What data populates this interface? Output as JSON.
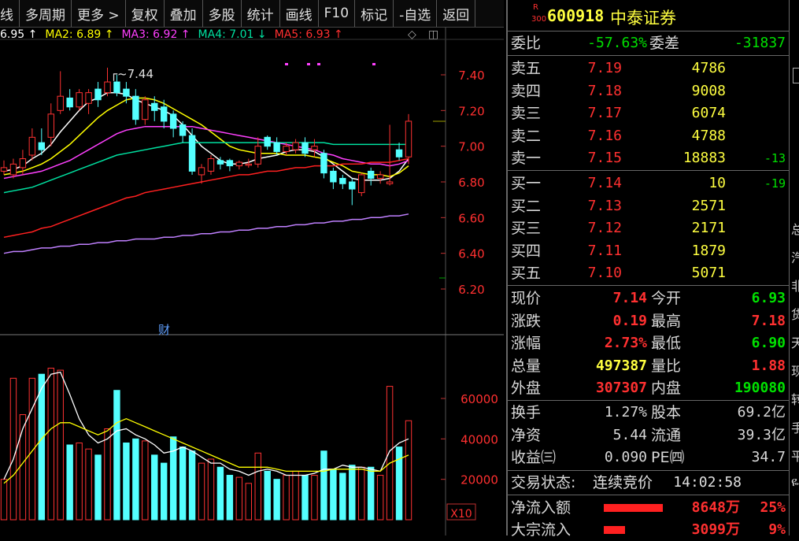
{
  "toolbar": {
    "items": [
      "线",
      "多周期",
      "更多 >",
      "复权",
      "叠加",
      "多股",
      "统计",
      "画线",
      "F10",
      "标记",
      "-自选",
      "返回"
    ]
  },
  "ma": [
    {
      "label": "6.95",
      "arrow": "↑",
      "color": "#ffffff"
    },
    {
      "label": "MA2: 6.89",
      "arrow": "↑",
      "color": "#ffff00"
    },
    {
      "label": "MA3: 6.92",
      "arrow": "↑",
      "color": "#ff40ff"
    },
    {
      "label": "MA4: 7.01",
      "arrow": "↓",
      "color": "#00e0a0"
    },
    {
      "label": "MA5: 6.93",
      "arrow": "↑",
      "color": "#ff3030"
    }
  ],
  "chart_data": {
    "type": "candlestick",
    "price_ticks": [
      "7.40",
      "7.20",
      "7.00",
      "6.80",
      "6.60",
      "6.40",
      "6.20"
    ],
    "price_range": [
      6.2,
      7.48
    ],
    "volume_ticks": [
      "60000",
      "40000",
      "20000"
    ],
    "volume_unit": "X10",
    "high_label": "7.44",
    "marker_label": "财",
    "candles": [
      {
        "o": 6.86,
        "c": 6.88,
        "h": 6.92,
        "l": 6.84,
        "v": 20000
      },
      {
        "o": 6.84,
        "c": 6.9,
        "h": 6.93,
        "l": 6.82,
        "v": 70000
      },
      {
        "o": 6.88,
        "c": 6.93,
        "h": 6.98,
        "l": 6.84,
        "v": 52000
      },
      {
        "o": 6.95,
        "c": 7.05,
        "h": 7.1,
        "l": 6.92,
        "v": 70000
      },
      {
        "o": 7.02,
        "c": 6.98,
        "h": 7.1,
        "l": 6.95,
        "v": 72000
      },
      {
        "o": 7.05,
        "c": 7.18,
        "h": 7.24,
        "l": 7.0,
        "v": 75000
      },
      {
        "o": 7.2,
        "c": 7.28,
        "h": 7.42,
        "l": 7.18,
        "v": 74000
      },
      {
        "o": 7.27,
        "c": 7.22,
        "h": 7.32,
        "l": 7.2,
        "v": 37000
      },
      {
        "o": 7.22,
        "c": 7.3,
        "h": 7.32,
        "l": 7.2,
        "v": 38000
      },
      {
        "o": 7.24,
        "c": 7.3,
        "h": 7.32,
        "l": 7.18,
        "v": 35000
      },
      {
        "o": 7.32,
        "c": 7.26,
        "h": 7.36,
        "l": 7.22,
        "v": 32000
      },
      {
        "o": 7.3,
        "c": 7.36,
        "h": 7.44,
        "l": 7.28,
        "v": 45000
      },
      {
        "o": 7.36,
        "c": 7.3,
        "h": 7.4,
        "l": 7.28,
        "v": 64000
      },
      {
        "o": 7.32,
        "c": 7.28,
        "h": 7.36,
        "l": 7.24,
        "v": 38000
      },
      {
        "o": 7.28,
        "c": 7.15,
        "h": 7.32,
        "l": 7.12,
        "v": 40000
      },
      {
        "o": 7.15,
        "c": 7.26,
        "h": 7.28,
        "l": 7.12,
        "v": 39000
      },
      {
        "o": 7.24,
        "c": 7.2,
        "h": 7.28,
        "l": 7.14,
        "v": 32000
      },
      {
        "o": 7.22,
        "c": 7.14,
        "h": 7.26,
        "l": 7.1,
        "v": 28000
      },
      {
        "o": 7.18,
        "c": 7.1,
        "h": 7.2,
        "l": 7.05,
        "v": 41000
      },
      {
        "o": 7.12,
        "c": 7.06,
        "h": 7.14,
        "l": 7.02,
        "v": 36000
      },
      {
        "o": 7.06,
        "c": 6.86,
        "h": 7.1,
        "l": 6.84,
        "v": 34000
      },
      {
        "o": 6.84,
        "c": 6.88,
        "h": 6.9,
        "l": 6.79,
        "v": 28000
      },
      {
        "o": 6.86,
        "c": 6.93,
        "h": 6.95,
        "l": 6.84,
        "v": 30000
      },
      {
        "o": 6.92,
        "c": 6.9,
        "h": 6.94,
        "l": 6.87,
        "v": 26000
      },
      {
        "o": 6.92,
        "c": 6.89,
        "h": 6.93,
        "l": 6.86,
        "v": 22000
      },
      {
        "o": 6.89,
        "c": 6.91,
        "h": 6.92,
        "l": 6.87,
        "v": 21000
      },
      {
        "o": 6.9,
        "c": 6.9,
        "h": 6.93,
        "l": 6.88,
        "v": 18000
      },
      {
        "o": 6.9,
        "c": 7.0,
        "h": 7.05,
        "l": 6.88,
        "v": 33000
      },
      {
        "o": 7.05,
        "c": 7.0,
        "h": 7.06,
        "l": 6.98,
        "v": 24000
      },
      {
        "o": 7.02,
        "c": 6.97,
        "h": 7.05,
        "l": 6.95,
        "v": 20000
      },
      {
        "o": 6.97,
        "c": 7.0,
        "h": 7.02,
        "l": 6.95,
        "v": 22000
      },
      {
        "o": 6.98,
        "c": 7.02,
        "h": 7.04,
        "l": 6.96,
        "v": 24000
      },
      {
        "o": 7.02,
        "c": 6.96,
        "h": 7.05,
        "l": 6.94,
        "v": 22000
      },
      {
        "o": 6.98,
        "c": 7.0,
        "h": 7.04,
        "l": 6.94,
        "v": 22000
      },
      {
        "o": 6.96,
        "c": 6.85,
        "h": 6.98,
        "l": 6.82,
        "v": 34000
      },
      {
        "o": 6.86,
        "c": 6.8,
        "h": 6.88,
        "l": 6.76,
        "v": 25000
      },
      {
        "o": 6.82,
        "c": 6.79,
        "h": 6.84,
        "l": 6.76,
        "v": 23000
      },
      {
        "o": 6.8,
        "c": 6.76,
        "h": 6.82,
        "l": 6.67,
        "v": 27000
      },
      {
        "o": 6.74,
        "c": 6.84,
        "h": 6.85,
        "l": 6.72,
        "v": 26000
      },
      {
        "o": 6.86,
        "c": 6.82,
        "h": 6.88,
        "l": 6.78,
        "v": 26000
      },
      {
        "o": 6.82,
        "c": 6.84,
        "h": 6.86,
        "l": 6.79,
        "v": 22000
      },
      {
        "o": 6.79,
        "c": 6.8,
        "h": 7.12,
        "l": 6.78,
        "v": 66000
      },
      {
        "o": 6.98,
        "c": 6.94,
        "h": 7.02,
        "l": 6.92,
        "v": 36000
      },
      {
        "o": 6.94,
        "c": 7.14,
        "h": 7.18,
        "l": 6.9,
        "v": 49000
      }
    ],
    "ma_lines": [
      {
        "name": "MA1",
        "color": "#ffffff",
        "values": [
          6.86,
          6.87,
          6.89,
          6.93,
          6.96,
          7.01,
          7.08,
          7.14,
          7.2,
          7.25,
          7.27,
          7.3,
          7.3,
          7.29,
          7.26,
          7.24,
          7.22,
          7.2,
          7.17,
          7.12,
          7.06,
          7.0,
          6.96,
          6.92,
          6.9,
          6.9,
          6.91,
          6.93,
          6.94,
          6.95,
          6.97,
          6.98,
          6.98,
          6.97,
          6.94,
          6.9,
          6.86,
          6.82,
          6.81,
          6.81,
          6.81,
          6.82,
          6.86,
          6.93
        ]
      },
      {
        "name": "MA2",
        "color": "#ffff00",
        "values": [
          6.84,
          6.85,
          6.86,
          6.88,
          6.9,
          6.93,
          6.97,
          7.01,
          7.06,
          7.11,
          7.16,
          7.2,
          7.23,
          7.26,
          7.27,
          7.27,
          7.26,
          7.24,
          7.21,
          7.18,
          7.15,
          7.12,
          7.08,
          7.04,
          7.0,
          6.98,
          6.97,
          6.96,
          6.96,
          6.96,
          6.95,
          6.95,
          6.95,
          6.94,
          6.93,
          6.91,
          6.89,
          6.86,
          6.85,
          6.84,
          6.84,
          6.83,
          6.85,
          6.89
        ]
      },
      {
        "name": "MA3",
        "color": "#ff40ff",
        "values": [
          6.82,
          6.83,
          6.84,
          6.85,
          6.86,
          6.88,
          6.9,
          6.92,
          6.95,
          6.98,
          7.01,
          7.04,
          7.07,
          7.09,
          7.1,
          7.11,
          7.11,
          7.11,
          7.11,
          7.11,
          7.11,
          7.1,
          7.09,
          7.08,
          7.07,
          7.06,
          7.05,
          7.04,
          7.03,
          7.02,
          7.01,
          7.0,
          6.99,
          6.98,
          6.96,
          6.95,
          6.93,
          6.92,
          6.91,
          6.9,
          6.9,
          6.89,
          6.9,
          6.92
        ]
      },
      {
        "name": "MA4",
        "color": "#00e0a0",
        "values": [
          6.74,
          6.75,
          6.76,
          6.77,
          6.79,
          6.81,
          6.83,
          6.85,
          6.87,
          6.89,
          6.91,
          6.93,
          6.95,
          6.96,
          6.97,
          6.98,
          6.99,
          7.0,
          7.01,
          7.02,
          7.02,
          7.02,
          7.02,
          7.02,
          7.02,
          7.02,
          7.02,
          7.02,
          7.02,
          7.02,
          7.02,
          7.02,
          7.02,
          7.02,
          7.02,
          7.01,
          7.01,
          7.01,
          7.01,
          7.01,
          7.01,
          7.01,
          7.01,
          7.01
        ]
      },
      {
        "name": "MA5",
        "color": "#ff2020",
        "values": [
          6.49,
          6.5,
          6.51,
          6.52,
          6.54,
          6.55,
          6.57,
          6.59,
          6.61,
          6.63,
          6.65,
          6.67,
          6.69,
          6.71,
          6.72,
          6.74,
          6.75,
          6.76,
          6.77,
          6.78,
          6.79,
          6.8,
          6.81,
          6.82,
          6.83,
          6.84,
          6.84,
          6.85,
          6.86,
          6.86,
          6.87,
          6.88,
          6.88,
          6.89,
          6.89,
          6.89,
          6.9,
          6.9,
          6.9,
          6.91,
          6.91,
          6.91,
          6.92,
          6.93
        ]
      },
      {
        "name": "MA6",
        "color": "#c080ff",
        "values": [
          6.4,
          6.41,
          6.41,
          6.42,
          6.43,
          6.43,
          6.44,
          6.44,
          6.45,
          6.45,
          6.46,
          6.46,
          6.47,
          6.47,
          6.48,
          6.48,
          6.48,
          6.49,
          6.49,
          6.5,
          6.5,
          6.51,
          6.51,
          6.52,
          6.52,
          6.53,
          6.53,
          6.54,
          6.54,
          6.55,
          6.55,
          6.56,
          6.56,
          6.57,
          6.57,
          6.58,
          6.58,
          6.59,
          6.59,
          6.6,
          6.6,
          6.61,
          6.61,
          6.62
        ]
      }
    ],
    "vol_lines": [
      {
        "name": "VMA1",
        "color": "#ffffff",
        "values": [
          20000,
          30000,
          45000,
          55000,
          65000,
          72000,
          73000,
          62000,
          50000,
          42000,
          38000,
          40000,
          44000,
          45000,
          42000,
          40000,
          37000,
          33000,
          34000,
          36000,
          34000,
          31000,
          28000,
          28000,
          25000,
          24000,
          22000,
          24000,
          25000,
          24000,
          22000,
          22000,
          22000,
          23000,
          25000,
          25000,
          27000,
          26000,
          26000,
          25000,
          24000,
          34000,
          38000,
          40000
        ]
      },
      {
        "name": "VMA2",
        "color": "#ffff00",
        "values": [
          18000,
          22000,
          28000,
          34000,
          40000,
          45000,
          48000,
          48000,
          46000,
          44000,
          42000,
          44000,
          48000,
          50000,
          48000,
          46000,
          44000,
          42000,
          40000,
          38000,
          36000,
          34000,
          32000,
          30000,
          28000,
          26000,
          26000,
          26000,
          26000,
          25000,
          24000,
          24000,
          24000,
          24000,
          24000,
          25000,
          25000,
          25000,
          25000,
          24000,
          24000,
          28000,
          30000,
          32000
        ]
      }
    ]
  },
  "quote": {
    "code_tag_top": "R",
    "code_tag_bottom": "300",
    "code": "600918",
    "name": "中泰证券",
    "weibi_label": "委比",
    "weibi_value": "-57.63%",
    "weicha_label": "委差",
    "weicha_value": "-31837",
    "asks": [
      {
        "label": "卖五",
        "price": "7.19",
        "vol": "4786",
        "chg": ""
      },
      {
        "label": "卖四",
        "price": "7.18",
        "vol": "9008",
        "chg": ""
      },
      {
        "label": "卖三",
        "price": "7.17",
        "vol": "6074",
        "chg": ""
      },
      {
        "label": "卖二",
        "price": "7.16",
        "vol": "4788",
        "chg": ""
      },
      {
        "label": "卖一",
        "price": "7.15",
        "vol": "18883",
        "chg": "-13"
      }
    ],
    "bids": [
      {
        "label": "买一",
        "price": "7.14",
        "vol": "10",
        "chg": "-19"
      },
      {
        "label": "买二",
        "price": "7.13",
        "vol": "2571",
        "chg": ""
      },
      {
        "label": "买三",
        "price": "7.12",
        "vol": "2171",
        "chg": ""
      },
      {
        "label": "买四",
        "price": "7.11",
        "vol": "1879",
        "chg": ""
      },
      {
        "label": "买五",
        "price": "7.10",
        "vol": "5071",
        "chg": ""
      }
    ],
    "stats1": [
      {
        "l1": "现价",
        "v1": "7.14",
        "c1": "#ff3030",
        "l2": "今开",
        "v2": "6.93",
        "c2": "#00e000"
      },
      {
        "l1": "涨跌",
        "v1": "0.19",
        "c1": "#ff3030",
        "l2": "最高",
        "v2": "7.18",
        "c2": "#ff3030"
      },
      {
        "l1": "涨幅",
        "v1": "2.73%",
        "c1": "#ff3030",
        "l2": "最低",
        "v2": "6.90",
        "c2": "#00e000"
      },
      {
        "l1": "总量",
        "v1": "497387",
        "c1": "#ffff40",
        "l2": "量比",
        "v2": "1.88",
        "c2": "#ff3030"
      },
      {
        "l1": "外盘",
        "v1": "307307",
        "c1": "#ff3030",
        "l2": "内盘",
        "v2": "190080",
        "c2": "#00e000"
      }
    ],
    "stats2": [
      {
        "l1": "换手",
        "v1": "1.27%",
        "c1": "#d8d8d8",
        "l2": "股本",
        "v2": "69.2亿",
        "c2": "#d8d8d8"
      },
      {
        "l1": "净资",
        "v1": "5.44",
        "c1": "#d8d8d8",
        "l2": "流通",
        "v2": "39.3亿",
        "c2": "#d8d8d8"
      },
      {
        "l1": "收益㈢",
        "v1": "0.090",
        "c1": "#d8d8d8",
        "l2": "PE㈣",
        "v2": "34.7",
        "c2": "#d8d8d8"
      }
    ],
    "trade_status_label": "交易状态:",
    "trade_status_value": "连续竞价",
    "trade_time": "14:02:58",
    "flow": [
      {
        "label": "净流入额",
        "value": "8648万",
        "pct": "25%",
        "bar": 0.25
      },
      {
        "label": "大宗流入",
        "value": "3099万",
        "pct": "9%",
        "bar": 0.09
      }
    ]
  },
  "far_right_chars": [
    "总",
    "汽",
    "非",
    "货",
    "天",
    "现",
    "转",
    "手",
    "平",
    "ዬ"
  ]
}
